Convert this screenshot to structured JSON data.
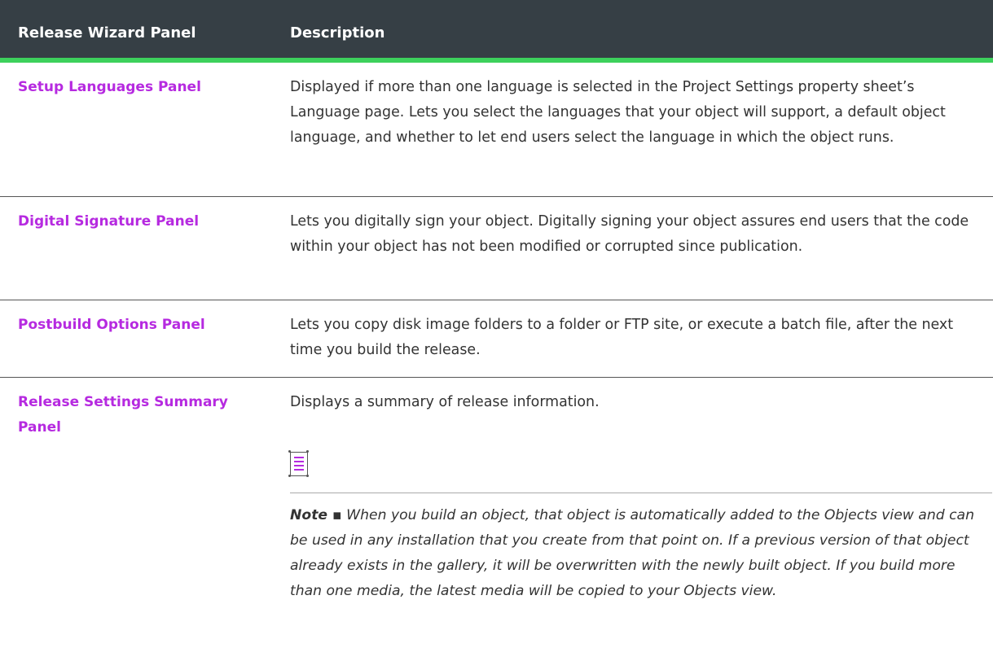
{
  "header": {
    "col1": "Release Wizard Panel",
    "col2": "Description"
  },
  "rows": [
    {
      "panel": "Setup Languages Panel",
      "description": "Displayed if more than one language is selected in the Project Settings property sheet’s Language page. Lets you select the languages that your object will support, a default object language, and whether to let end users select the language in which the object runs."
    },
    {
      "panel": "Digital Signature Panel",
      "description": "Lets you digitally sign your object. Digitally signing your object assures end users that the code within your object has not been modified or corrupted since publication."
    },
    {
      "panel": "Postbuild Options Panel",
      "description": "Lets you copy disk image folders to a folder or FTP site, or execute a batch file, after the next time you build the release."
    },
    {
      "panel": "Release Settings Summary Panel",
      "description": "Displays a summary of release information."
    }
  ],
  "note": {
    "label": "Note ▪",
    "text": "When you build an object, that object is automatically added to the Objects view and can be used in any installation that you create from that point on. If a previous version of that object already exists in the gallery, it will be overwritten with the newly built object. If you build more than one media, the latest media will be copied to your Objects view."
  },
  "colors": {
    "header_bg": "#363f45",
    "accent": "#3dd15c",
    "link": "#b62ae0"
  }
}
